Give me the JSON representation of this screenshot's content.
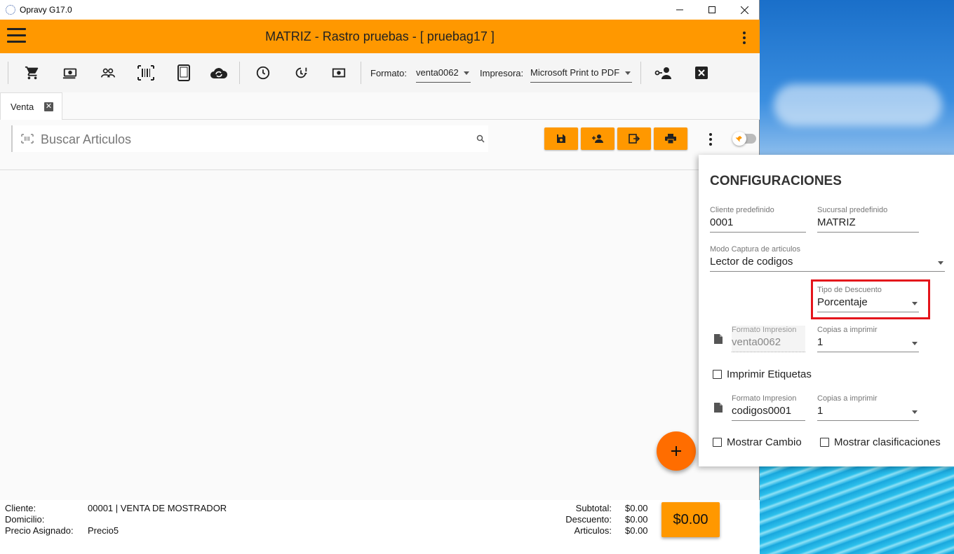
{
  "window": {
    "app_title": "Opravy G17.0"
  },
  "header": {
    "title": "MATRIZ - Rastro pruebas - [ pruebag17 ]"
  },
  "toolbar": {
    "formato_label": "Formato:",
    "formato_value": "venta0062",
    "impresora_label": "Impresora:",
    "impresora_value": "Microsoft Print to PDF",
    "icons": [
      "cart-icon",
      "cash-icon",
      "people-icon",
      "barcode-icon",
      "tablet-icon",
      "cloud-sync-icon",
      "clock-icon",
      "clock-alert-icon",
      "money-icon",
      "person-key-icon",
      "close-box-icon"
    ]
  },
  "tabs": [
    {
      "label": "Venta"
    }
  ],
  "search": {
    "placeholder": "Buscar Articulos"
  },
  "footer": {
    "cliente_label": "Cliente:",
    "cliente_value": "00001 | VENTA DE MOSTRADOR",
    "domicilio_label": "Domicilio:",
    "domicilio_value": "",
    "precio_label": "Precio Asignado:",
    "precio_value": "Precio5",
    "subtotal_label": "Subtotal:",
    "subtotal_value": "$0.00",
    "descuento_label": "Descuento:",
    "descuento_value": "$0.00",
    "articulos_label": "Articulos:",
    "articulos_value": "$0.00",
    "total": "$0.00"
  },
  "config": {
    "title": "CONFIGURACIONES",
    "cliente": {
      "label": "Cliente predefinido",
      "value": "0001"
    },
    "sucursal": {
      "label": "Sucursal predefinido",
      "value": "MATRIZ"
    },
    "modo": {
      "label": "Modo Captura de articulos",
      "value": "Lector de codigos"
    },
    "descuento": {
      "label": "Tipo de Descuento",
      "value": "Porcentaje"
    },
    "formato1": {
      "label": "Formato Impresion",
      "value": "venta0062"
    },
    "copias1": {
      "label": "Copias a imprimir",
      "value": "1"
    },
    "imprimir_etiquetas": {
      "label": "Imprimir Etiquetas",
      "checked": false
    },
    "formato2": {
      "label": "Formato Impresion",
      "value": "codigos0001"
    },
    "copias2": {
      "label": "Copias a imprimir",
      "value": "1"
    },
    "mostrar_cambio": {
      "label": "Mostrar Cambio",
      "checked": false
    },
    "mostrar_clasificaciones": {
      "label": "Mostrar clasificaciones",
      "checked": false
    }
  },
  "colors": {
    "accent": "#ff9800",
    "fab": "#ff6d00",
    "highlight": "#e4141b"
  }
}
